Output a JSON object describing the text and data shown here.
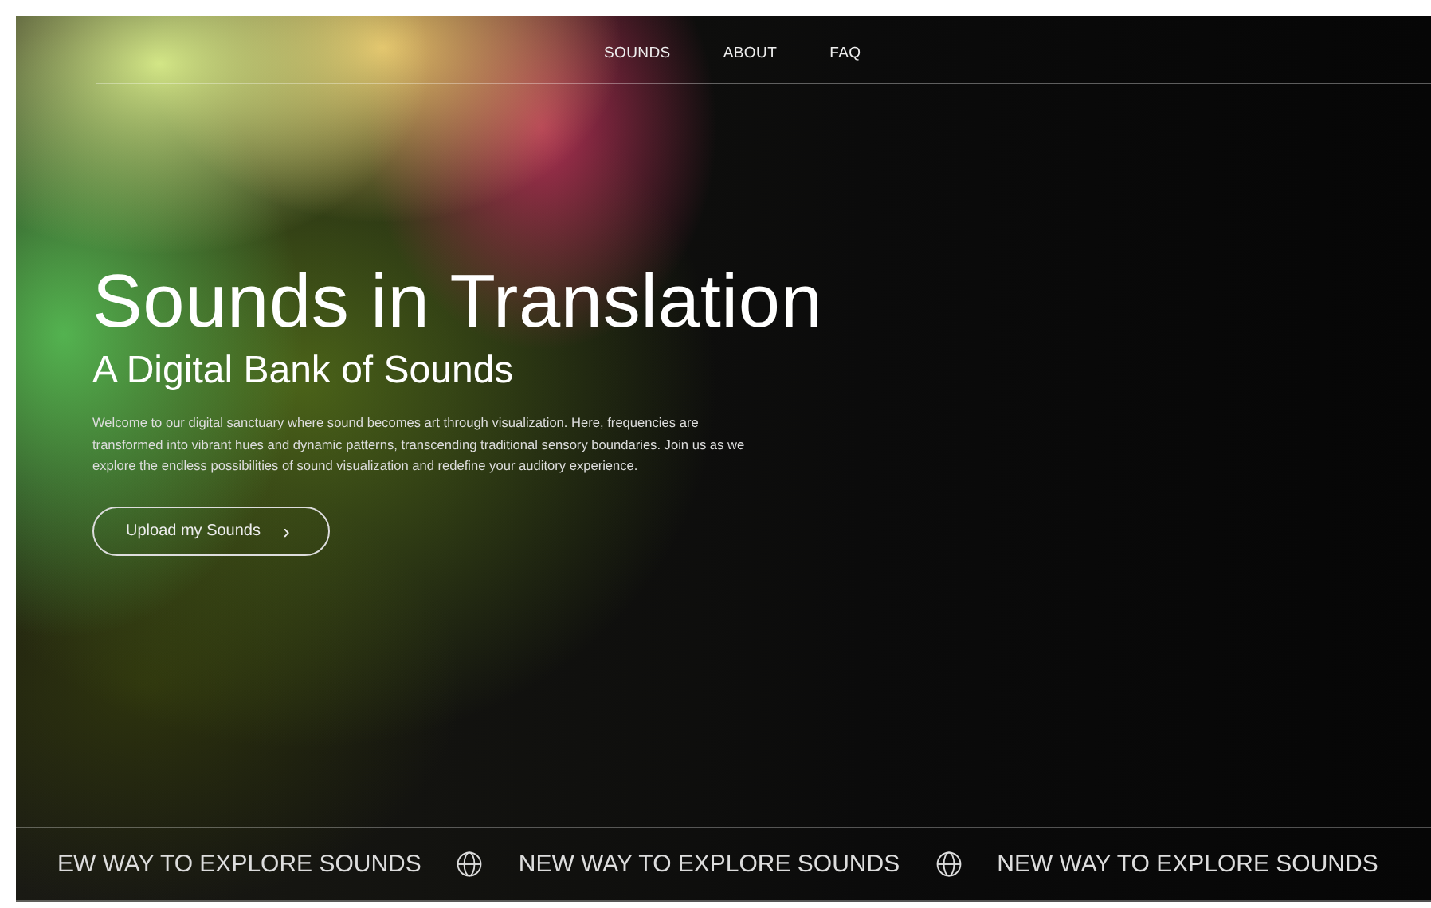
{
  "nav": [
    {
      "label": "SOUNDS"
    },
    {
      "label": "ABOUT"
    },
    {
      "label": "FAQ"
    }
  ],
  "hero": {
    "title": "Sounds in Translation",
    "subtitle": "A Digital Bank of Sounds",
    "description": "Welcome to our digital sanctuary where sound becomes art through visualization. Here, frequencies are transformed into vibrant hues and dynamic patterns, transcending traditional sensory boundaries. Join us as we explore the endless possibilities of sound visualization and redefine your auditory experience.",
    "button": {
      "label": "Upload my Sounds",
      "icon": "›"
    }
  },
  "ticker": [
    {
      "text": "EW WAY TO EXPLORE SOUNDS"
    },
    {
      "text": "NEW WAY TO EXPLORE SOUNDS"
    },
    {
      "text": "NEW WAY TO EXPLORE SOUNDS"
    }
  ]
}
